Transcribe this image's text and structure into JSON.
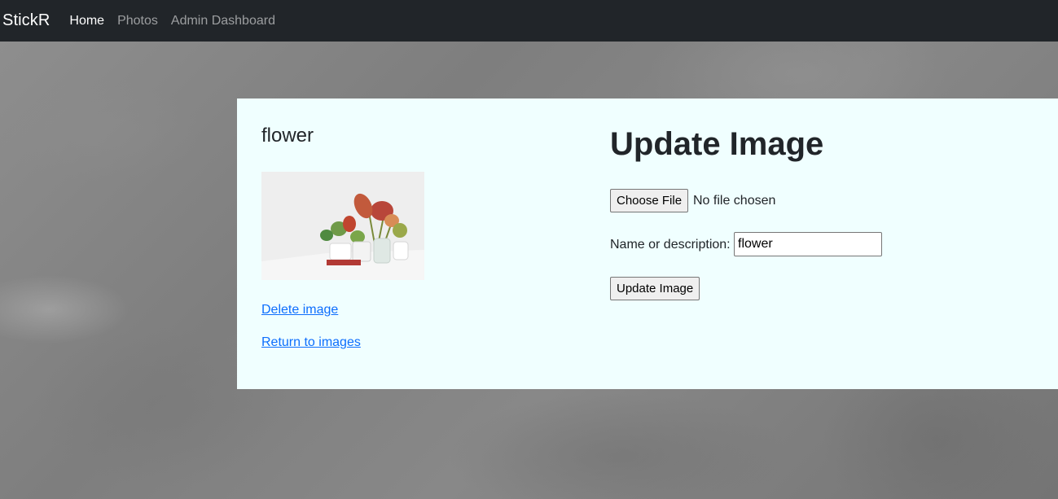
{
  "navbar": {
    "brand": "StickR",
    "links": [
      "Home",
      "Photos",
      "Admin Dashboard"
    ],
    "active_link": "Home"
  },
  "image_panel": {
    "title": "flower",
    "delete_link": "Delete image",
    "return_link": "Return to images"
  },
  "form": {
    "heading": "Update Image",
    "file_button": "Choose File",
    "file_status": "No file chosen",
    "name_label": "Name or description:",
    "name_value": "flower",
    "submit_label": "Update Image"
  },
  "colors": {
    "navbar_bg": "#212529",
    "card_bg": "#f0ffff",
    "link": "#0d6efd"
  }
}
